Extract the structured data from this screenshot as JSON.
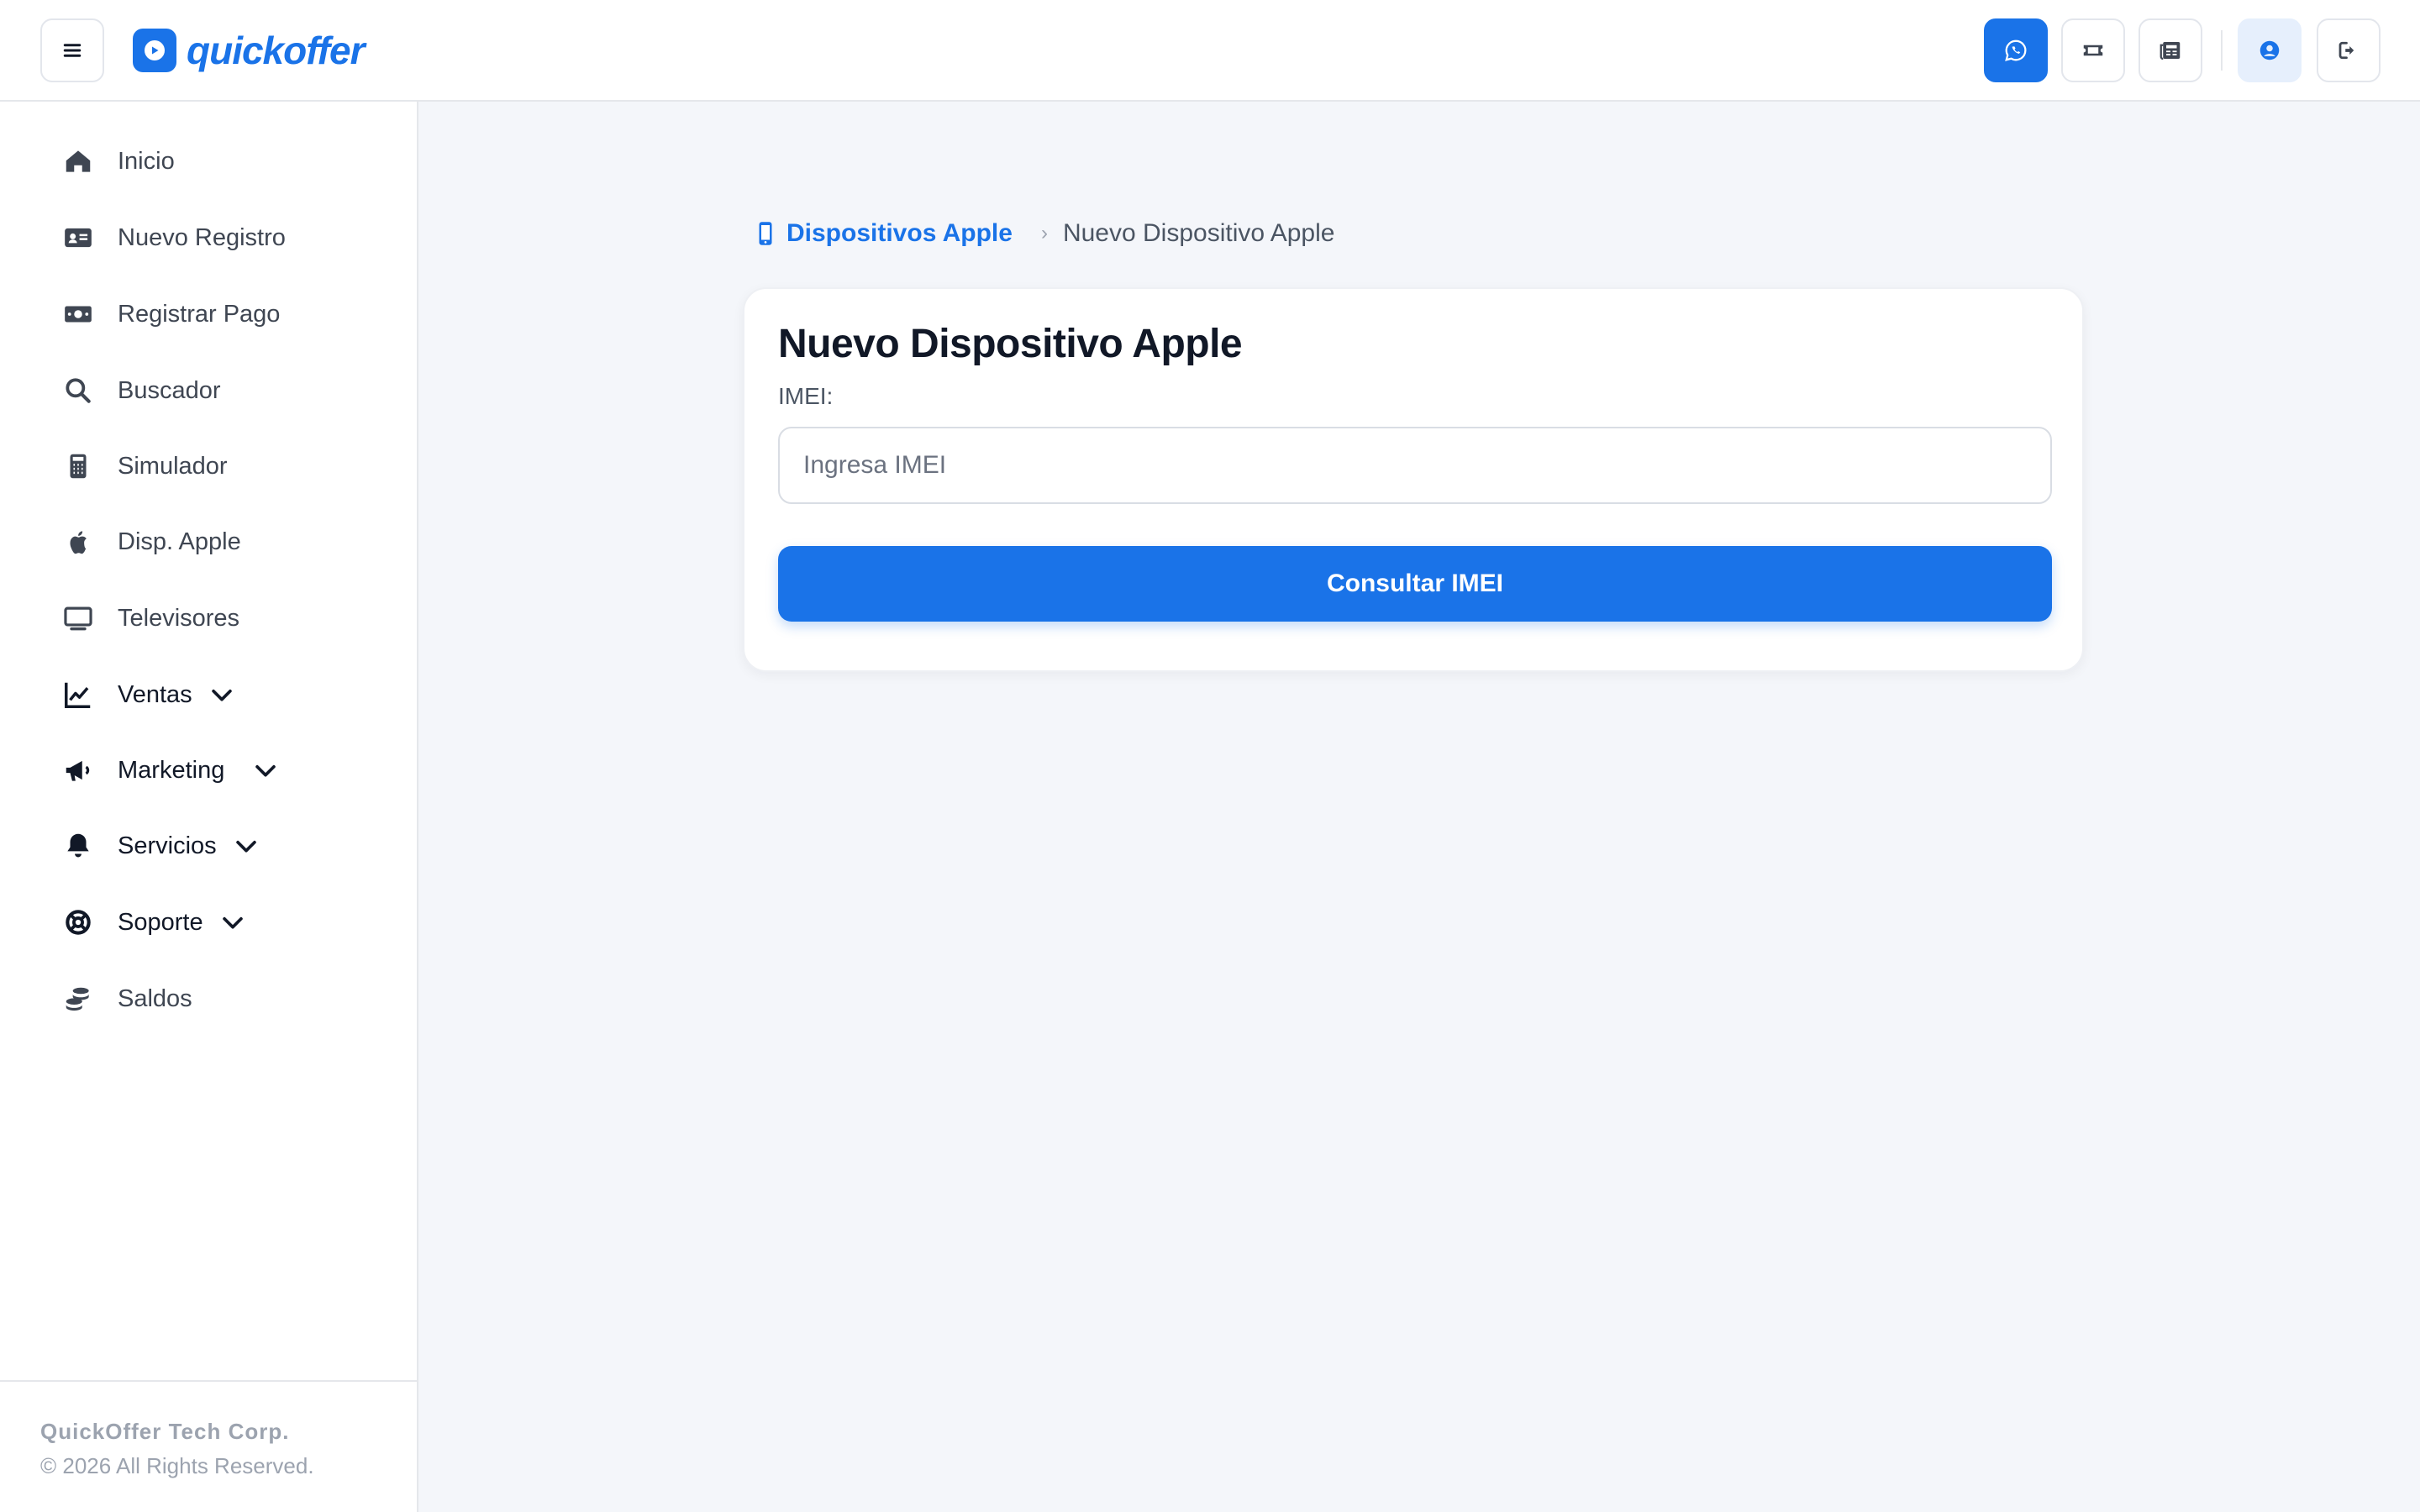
{
  "header": {
    "logo_text": "quickoffer",
    "icons": [
      "menu-icon",
      "whatsapp-icon",
      "ticket-icon",
      "newspaper-icon",
      "user-circle-icon",
      "logout-icon"
    ]
  },
  "sidebar": {
    "items": [
      {
        "label": "Inicio",
        "icon": "home-icon"
      },
      {
        "label": "Nuevo Registro",
        "icon": "id-card-icon"
      },
      {
        "label": "Registrar Pago",
        "icon": "money-icon"
      },
      {
        "label": "Buscador",
        "icon": "search-icon"
      },
      {
        "label": "Simulador",
        "icon": "calculator-icon"
      },
      {
        "label": "Disp. Apple",
        "icon": "apple-icon"
      },
      {
        "label": "Televisores",
        "icon": "tv-icon"
      },
      {
        "label": "Ventas",
        "icon": "chart-line-icon"
      },
      {
        "label": "Marketing",
        "icon": "megaphone-icon"
      },
      {
        "label": "Servicios",
        "icon": "bell-icon"
      },
      {
        "label": "Soporte",
        "icon": "lifebuoy-icon"
      },
      {
        "label": "Saldos",
        "icon": "coins-icon"
      }
    ],
    "footer": {
      "company": "QuickOffer Tech Corp.",
      "copyright": "© 2026 All Rights Reserved."
    }
  },
  "breadcrumb": {
    "parent": "Dispositivos Apple",
    "separator": "›",
    "current": "Nuevo Dispositivo Apple"
  },
  "form": {
    "title": "Nuevo Dispositivo Apple",
    "imei_label": "IMEI:",
    "imei_placeholder": "Ingresa IMEI",
    "imei_value": "",
    "submit_label": "Consultar IMEI"
  },
  "colors": {
    "accent": "#1a73e8",
    "background": "#f4f6fa",
    "text_dark": "#111827",
    "text_muted": "#9ca3af"
  }
}
